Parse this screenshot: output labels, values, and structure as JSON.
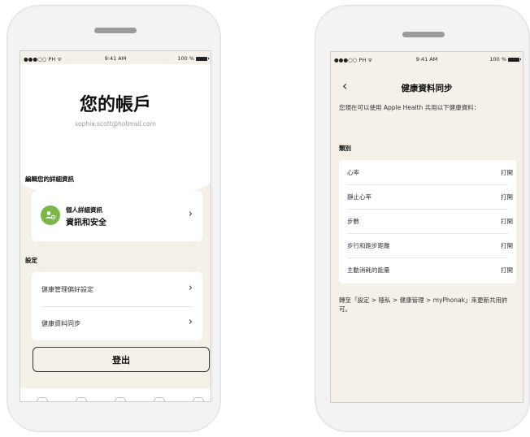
{
  "left": {
    "status": {
      "carrier": "●●●○○ PH ᯤ",
      "time": "9:41 AM",
      "battery": "100 %"
    },
    "title": "您的帳戶",
    "email": "sophia.scott@hotmail.com",
    "details_section": "編輯您的詳細資訊",
    "personal": {
      "line1": "個人詳細資訊",
      "line2": "資訊和安全"
    },
    "settings_section": "設定",
    "settings_items": [
      "健康管理偏好設定",
      "健康資料同步"
    ],
    "logout": "登出",
    "colors": {
      "avatar": "#7ab648"
    }
  },
  "right": {
    "status": {
      "carrier": "●●●○○ PH ᯤ",
      "time": "9:41 AM",
      "battery": "100 %"
    },
    "title": "健康資料同步",
    "intro": "您現在可以使用 Apple Health 共用以下健康資料：",
    "category_label": "類別",
    "items": [
      {
        "label": "心率",
        "value": "打開"
      },
      {
        "label": "靜止心率",
        "value": "打開"
      },
      {
        "label": "步數",
        "value": "打開"
      },
      {
        "label": "步行和跑步距離",
        "value": "打開"
      },
      {
        "label": "主動消耗的能量",
        "value": "打開"
      }
    ],
    "footer": "轉至「設定 > 隱私 > 健康管理 > myPhonak」來更新共用許可。"
  }
}
